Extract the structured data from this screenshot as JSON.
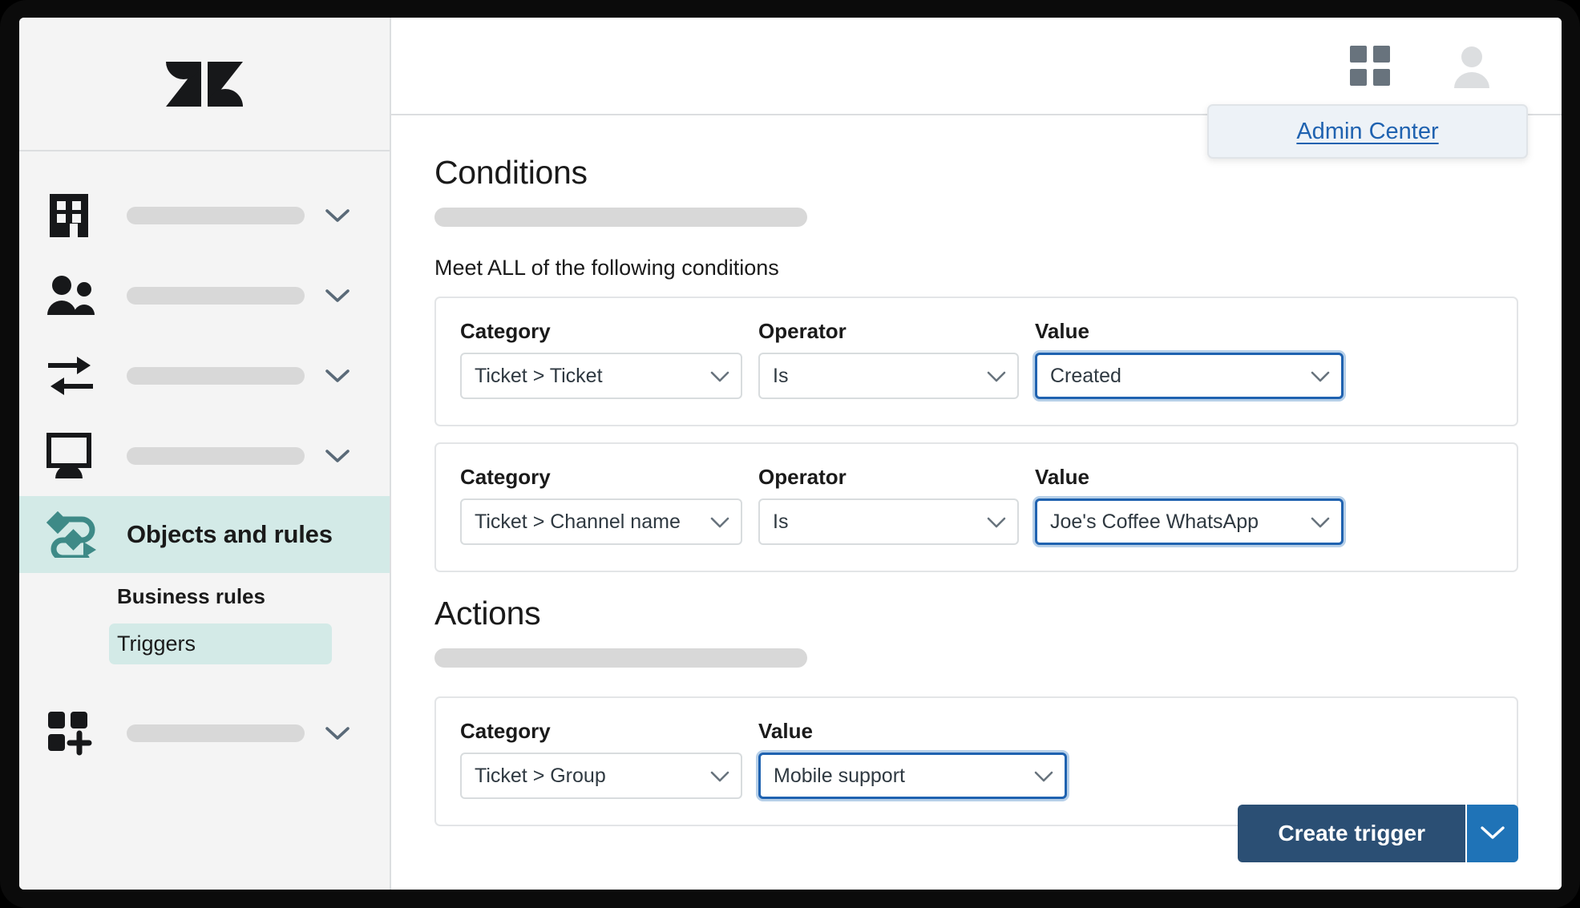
{
  "sidebar": {
    "logo_name": "zendesk-logo",
    "nav_items": [
      {
        "icon": "building-icon",
        "label": ""
      },
      {
        "icon": "people-icon",
        "label": ""
      },
      {
        "icon": "arrows-exchange-icon",
        "label": ""
      },
      {
        "icon": "monitor-icon",
        "label": ""
      }
    ],
    "active_item": {
      "icon": "objects-and-rules-icon",
      "label": "Objects and rules"
    },
    "sub_items": [
      {
        "label": "Business rules",
        "selected": false
      },
      {
        "label": "Triggers",
        "selected": true
      }
    ],
    "bottom_item": {
      "icon": "apps-add-icon",
      "label": ""
    }
  },
  "topbar": {
    "grid_icon": "grid-apps-icon",
    "avatar_icon": "user-avatar-icon"
  },
  "dropdown": {
    "admin_center_label": "Admin Center"
  },
  "conditions": {
    "heading": "Conditions",
    "meet_label": "Meet ALL of the following conditions",
    "labels": {
      "category": "Category",
      "operator": "Operator",
      "value": "Value"
    },
    "rows": [
      {
        "category": "Ticket > Ticket",
        "operator": "Is",
        "value": "Created",
        "value_focused": true
      },
      {
        "category": "Ticket > Channel name",
        "operator": "Is",
        "value": "Joe's Coffee WhatsApp",
        "value_focused": true
      }
    ]
  },
  "actions": {
    "heading": "Actions",
    "labels": {
      "category": "Category",
      "value": "Value"
    },
    "rows": [
      {
        "category": "Ticket > Group",
        "value": "Mobile support",
        "value_focused": true
      }
    ]
  },
  "footer": {
    "primary_label": "Create trigger",
    "split_icon": "chevron-down-icon"
  },
  "colors": {
    "accent_teal": "#3e8a87",
    "active_bg": "#d3eae7",
    "link_blue": "#1f62b0",
    "focus_blue": "#1f62b0",
    "button_navy": "#2b4f74",
    "button_blue": "#1f73b7",
    "sidebar_bg": "#f4f4f4",
    "skeleton_gray": "#d8d8d8"
  }
}
